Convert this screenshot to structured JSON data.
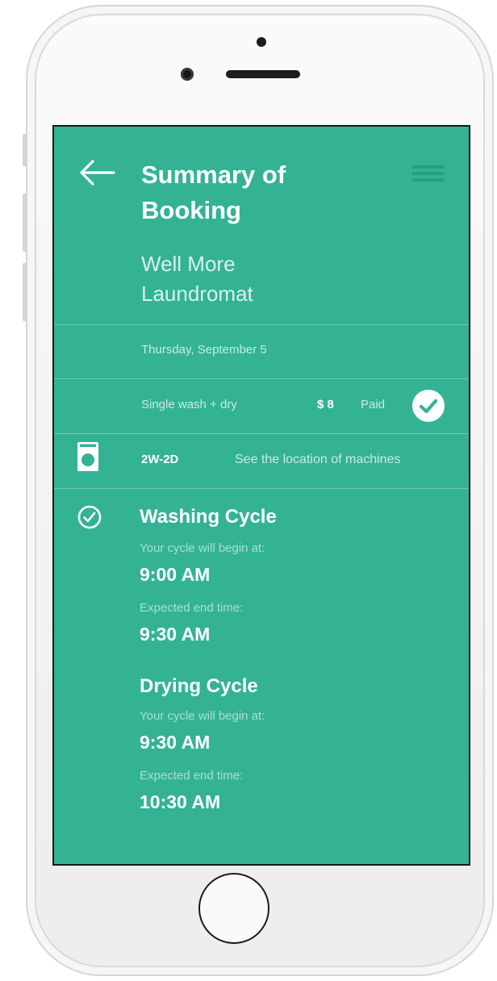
{
  "header": {
    "title": "Summary of\nBooking",
    "venue": "Well More\nLaundromat",
    "icons": {
      "back": "arrow-left-icon",
      "menu": "hamburger-menu-icon"
    }
  },
  "booking": {
    "date": "Thursday, September 5",
    "service": "Single wash + dry",
    "price": "$ 8",
    "payment_status": "Paid"
  },
  "machine": {
    "id": "2W-2D",
    "location_link": "See the location of machines"
  },
  "cycles": [
    {
      "title": "Washing Cycle",
      "begin_label": "Your cycle will begin at:",
      "begin_time": "9:00 AM",
      "end_label": "Expected end time:",
      "end_time": "9:30 AM"
    },
    {
      "title": "Drying Cycle",
      "begin_label": "Your cycle will begin at:",
      "begin_time": "9:30 AM",
      "end_label": "Expected end time:",
      "end_time": "10:30 AM"
    }
  ],
  "colors": {
    "accent": "#33b394",
    "menu_icon": "#22a07f",
    "divider": "#6fcab4"
  }
}
